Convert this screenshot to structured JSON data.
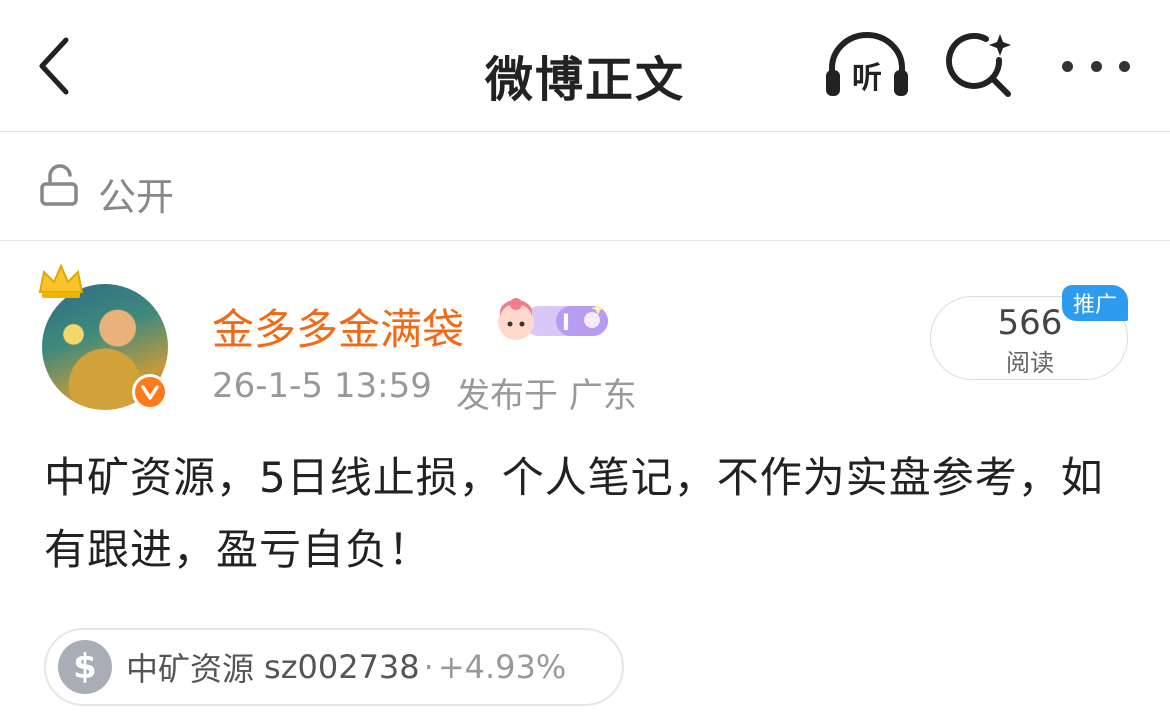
{
  "header": {
    "title": "微博正文",
    "listen_label": "听"
  },
  "privacy": {
    "label": "公开"
  },
  "post": {
    "username": "金多多金满袋",
    "time": "26-1-5 13:59",
    "location": "发布于 广东",
    "read_count": "566",
    "read_label": "阅读",
    "promo_tag": "推广",
    "content": "中矿资源，5日线止损，个人笔记，不作为实盘参考，如有跟进，盈亏自负！"
  },
  "stock": {
    "name": "中矿资源",
    "code": "sz002738",
    "separator": "·",
    "change": "+4.93%"
  },
  "colors": {
    "username": "#f26a15",
    "verified": "#ff7a1a",
    "promo": "#2d9bf0"
  },
  "icons": [
    "back-arrow-icon",
    "headphones-listen-icon",
    "search-sparkle-icon",
    "more-dots-icon",
    "lock-open-icon",
    "crown-icon",
    "verified-v-icon",
    "user-badge-icon",
    "dollar-icon"
  ]
}
